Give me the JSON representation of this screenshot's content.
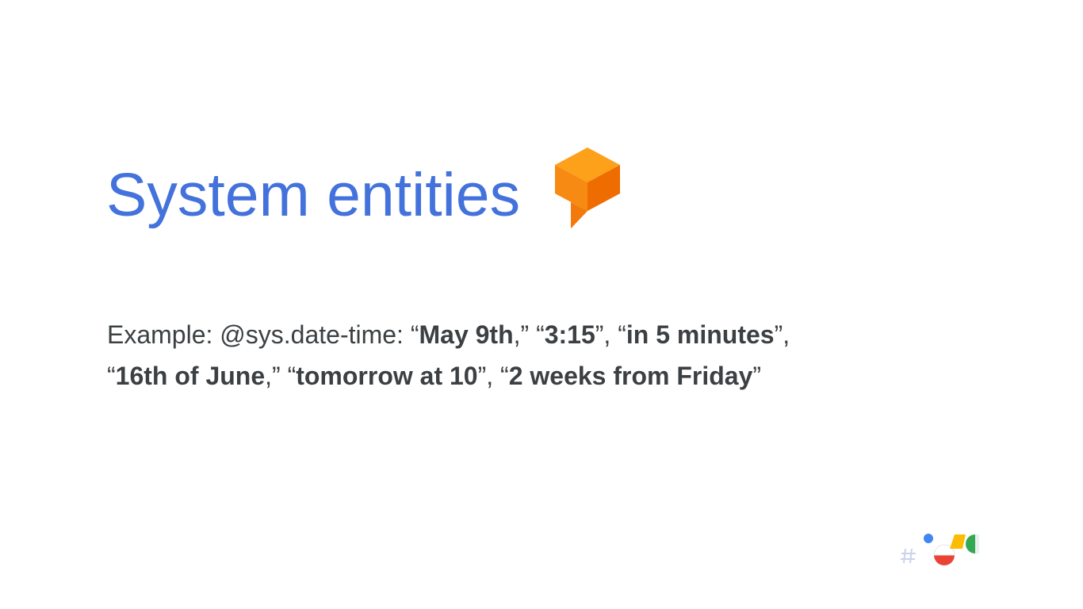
{
  "slide": {
    "title": "System entities",
    "example_prefix": "Example: @sys.date-time: ",
    "examples": [
      {
        "open": "“",
        "text": "May 9th",
        "close": ",” "
      },
      {
        "open": "“",
        "text": "3:15",
        "close": "”, "
      },
      {
        "open": "“",
        "text": "in 5 minutes",
        "close": "”,"
      },
      {
        "open": "“",
        "text": "16th of June",
        "close": ",” "
      },
      {
        "open": "“",
        "text": "tomorrow at 10",
        "close": "”, "
      },
      {
        "open": "“",
        "text": "2 weeks from Friday",
        "close": "”"
      }
    ]
  },
  "colors": {
    "title": "#4472dc",
    "body_text": "#3c4043",
    "logo_orange_top": "#fda01a",
    "logo_orange_mid": "#f68a12",
    "logo_orange_side": "#ef6c00",
    "io_blue": "#4285f4",
    "io_red": "#ea4335",
    "io_yellow": "#fbbc04",
    "io_green": "#34a853"
  },
  "icons": {
    "product_logo": "dialogflow-logo-icon",
    "event_logo": "google-io-logo-icon"
  }
}
